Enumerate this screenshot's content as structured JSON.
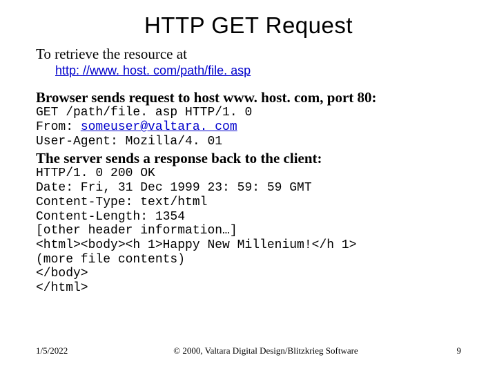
{
  "title": "HTTP GET Request",
  "intro": "To retrieve the resource at",
  "url": "http: //www. host. com/path/file. asp",
  "section1": "Browser sends request to host www. host. com, port 80:",
  "request": {
    "line1": "GET /path/file. asp HTTP/1. 0",
    "from_label": "From: ",
    "from_email": "someuser@valtara. com",
    "ua": "User-Agent: Mozilla/4. 01"
  },
  "section2": "The server sends a response back to the client:",
  "response": {
    "l1": "HTTP/1. 0 200 OK",
    "l2": "Date: Fri, 31 Dec 1999 23: 59: 59 GMT",
    "l3": "Content-Type: text/html",
    "l4": "Content-Length: 1354",
    "l5": "[other header information…]",
    "l6": "<html><body><h 1>Happy New Millenium!</h 1>",
    "l7": "(more file contents)",
    "l8": "</body>",
    "l9": "</html>"
  },
  "footer": {
    "date": "1/5/2022",
    "copyright": "© 2000, Valtara Digital Design/Blitzkrieg Software",
    "page": "9"
  }
}
